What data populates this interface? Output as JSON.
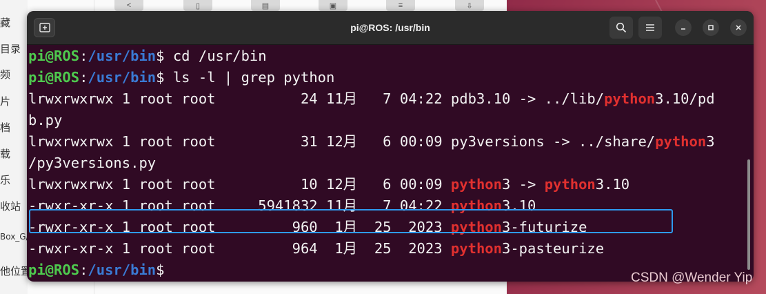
{
  "background": {
    "sidebar_items": [
      "藏",
      "目录",
      "频",
      "片",
      "档",
      "载",
      "乐",
      "收站",
      "Box_G/",
      "他位置"
    ]
  },
  "window": {
    "title": "pi@ROS: /usr/bin"
  },
  "terminal": {
    "prompt_user": "pi@ROS",
    "prompt_sep": ":",
    "prompt_path": "/usr/bin",
    "prompt_symbol": "$",
    "commands": [
      "cd /usr/bin",
      "ls -l | grep python"
    ],
    "listing": [
      {
        "pre": "lrwxrwxrwx 1 root root          24 11月   7 04:22 pdb3.10 -> ../lib/",
        "m1": "python",
        "mid": "3.10/pd",
        "m2": "",
        "post": ""
      },
      {
        "pre": "b.py",
        "m1": "",
        "mid": "",
        "m2": "",
        "post": ""
      },
      {
        "pre": "lrwxrwxrwx 1 root root          31 12月   6 00:09 py3versions -> ../share/",
        "m1": "python",
        "mid": "3",
        "m2": "",
        "post": ""
      },
      {
        "pre": "/py3versions.py",
        "m1": "",
        "mid": "",
        "m2": "",
        "post": ""
      },
      {
        "pre": "lrwxrwxrwx 1 root root          10 12月   6 00:09 ",
        "m1": "python",
        "mid": "3 -> ",
        "m2": "python",
        "post": "3.10"
      },
      {
        "pre": "-rwxr-xr-x 1 root root     5941832 11月   7 04:22 ",
        "m1": "python",
        "mid": "3.10",
        "m2": "",
        "post": ""
      },
      {
        "pre": "-rwxr-xr-x 1 root root         960  1月  25  2023 ",
        "m1": "python",
        "mid": "3-futurize",
        "m2": "",
        "post": ""
      },
      {
        "pre": "-rwxr-xr-x 1 root root         964  1月  25  2023 ",
        "m1": "python",
        "mid": "3-pasteurize",
        "m2": "",
        "post": ""
      }
    ]
  },
  "watermark": "CSDN @Wender Yip",
  "colors": {
    "terminal_bg": "#300a24",
    "prompt_user": "#4ec94e",
    "prompt_path": "#3a7bd5",
    "match": "#e0302f",
    "highlight_border": "#2e9bf0"
  },
  "icons": [
    "new-tab-icon",
    "search-icon",
    "hamburger-menu-icon",
    "minimize-icon",
    "maximize-icon",
    "close-icon"
  ]
}
